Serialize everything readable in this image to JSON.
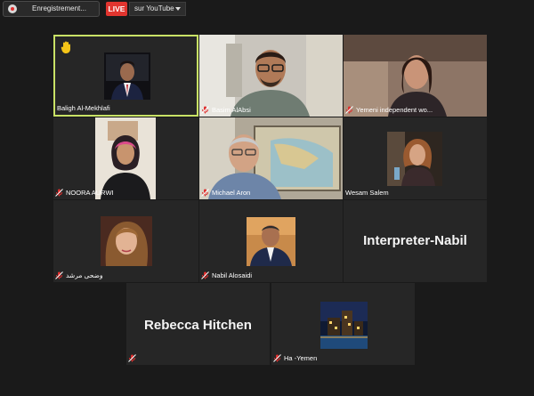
{
  "recording": {
    "label": "Enregistrement..."
  },
  "live": {
    "badge": "LIVE",
    "destination": "sur YouTube"
  },
  "participants": [
    {
      "name": "Baligh Al-Mekhlafi",
      "raised_hand": true,
      "active_speaker": true
    },
    {
      "name": "Basim AlAbsi"
    },
    {
      "name": "Yemeni independent wo..."
    },
    {
      "name": "NOORA AURWI"
    },
    {
      "name": "Michael Aron"
    },
    {
      "name": "Wesam Salem"
    },
    {
      "name": "وضحى مرشد"
    },
    {
      "name": "Nabil Alosaidi"
    },
    {
      "name": "Interpreter-Nabil"
    },
    {
      "name": "Rebecca Hitchen"
    },
    {
      "name": "Ha -Yemen"
    }
  ],
  "colors": {
    "active_border": "#c9e266",
    "live_red": "#e1352f",
    "muted_mic": "#e0302f",
    "hand": "#f5c518"
  }
}
